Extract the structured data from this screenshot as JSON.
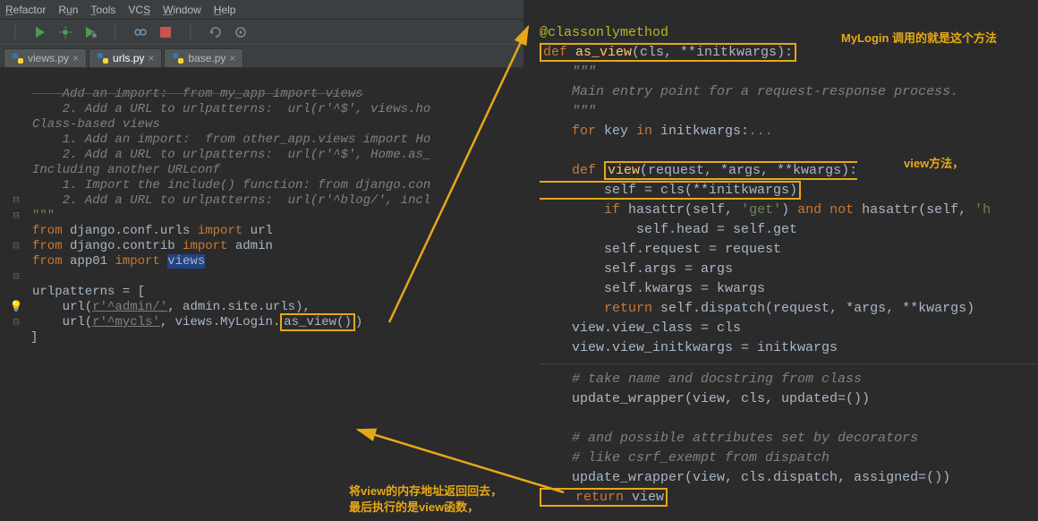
{
  "menu": {
    "refactor": "Refactor",
    "run": "Run",
    "tools": "Tools",
    "vcs": "VCS",
    "window": "Window",
    "help": "Help"
  },
  "tabs": {
    "views": "views.py",
    "urls": "urls.py",
    "base": "base.py"
  },
  "left_code": {
    "l1": "    Add an import:  from my_app import views",
    "l2": "    2. Add a URL to urlpatterns:  url(r'^$', views.ho",
    "l3": "Class-based views",
    "l4": "    1. Add an import:  from other_app.views import Ho",
    "l5": "    2. Add a URL to urlpatterns:  url(r'^$', Home.as_",
    "l6": "Including another URLconf",
    "l7": "    1. Import the include() function: from django.con",
    "l8": "    2. Add a URL to urlpatterns:  url(r'^blog/', incl",
    "l9": "\"\"\"",
    "from1_a": "from",
    "from1_b": "django.conf.urls",
    "from1_c": "import",
    "from1_d": "url",
    "from2_a": "from",
    "from2_b": "django.contrib",
    "from2_c": "import",
    "from2_d": "admin",
    "from3_a": "from",
    "from3_b": "app01",
    "from3_c": "import",
    "from3_d": "views",
    "urlpat": "urlpatterns = [",
    "u1a": "    url(",
    "u1s": "r'^admin/'",
    "u1b": ", admin.site.urls),",
    "u2a": "    url(",
    "u2s": "r'^mycls'",
    "u2b": ", views.MyLogin.",
    "u2c": "as_view()",
    "u2d": ")",
    "close": "]"
  },
  "right_code": {
    "deco": "@classonlymethod",
    "def_as_view_a": "def ",
    "def_as_view_b": "as_view",
    "def_as_view_c": "(cls, **initkwargs):",
    "doc1": "    \"\"\"",
    "doc2": "    Main entry point for a request-response process.",
    "doc3": "    \"\"\"",
    "for_a": "    for ",
    "for_b": "key ",
    "for_c": "in ",
    "for_d": "initkwargs:",
    "for_e": "...",
    "defview_a": "    def ",
    "defview_b": "view",
    "defview_c": "(request, *args, **kwargs):",
    "selfcls_a": "        self = cls(**initkwargs)",
    "if_a": "        if ",
    "if_b": "hasattr(self, ",
    "if_c": "'get'",
    "if_d": ") ",
    "if_e": "and not ",
    "if_f": "hasattr(self, ",
    "if_g": "'h",
    "head": "            self.head = self.get",
    "req": "        self.request = request",
    "args": "        self.args = args",
    "kwargs": "        self.kwargs = kwargs",
    "ret1_a": "        return ",
    "ret1_b": "self.dispatch(request, *args, **kwargs)",
    "vc": "    view.view_class = cls",
    "vk": "    view.view_initkwargs = initkwargs",
    "c1": "    # take name and docstring from class",
    "uw1": "    update_wrapper(view, cls, updated=())",
    "c2": "    # and possible attributes set by decorators",
    "c3": "    # like csrf_exempt from dispatch",
    "uw2": "    update_wrapper(view, cls.dispatch, assigned=())",
    "ret2_a": "    return ",
    "ret2_b": "view"
  },
  "annotations": {
    "a1": "MyLogin 调用的就是这个方法",
    "a2": "view方法，",
    "a3a": "将view的内存地址返回回去，",
    "a3b": "最后执行的是view函数，"
  }
}
